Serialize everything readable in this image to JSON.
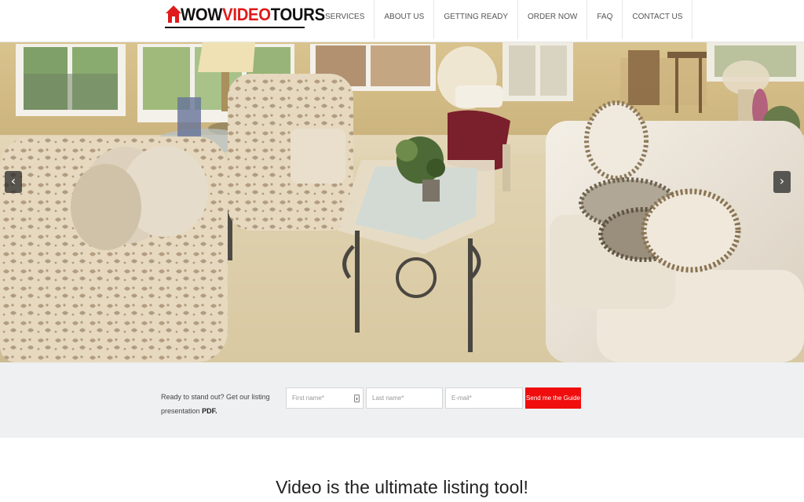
{
  "brand": {
    "logo_part1": "WOW",
    "logo_part2": "VIDEO",
    "logo_part3": "TOURS",
    "accent_color": "#e01b1b"
  },
  "nav": {
    "items": [
      "SERVICES",
      "ABOUT US",
      "GETTING READY",
      "ORDER NOW",
      "FAQ",
      "CONTACT US"
    ]
  },
  "hero": {
    "prev_icon": "chevron-left-icon",
    "next_icon": "chevron-right-icon",
    "prev_glyph": "‹",
    "next_glyph": "›"
  },
  "signup": {
    "text": "Ready to stand out? Get our listing presentation",
    "text_bold": "PDF.",
    "first_name_placeholder": "First name*",
    "last_name_placeholder": "Last name*",
    "email_placeholder": "E-mail*",
    "button_label": "Send me the Guide",
    "button_color": "#f00d0d"
  },
  "headline": "Video is the ultimate listing tool!"
}
